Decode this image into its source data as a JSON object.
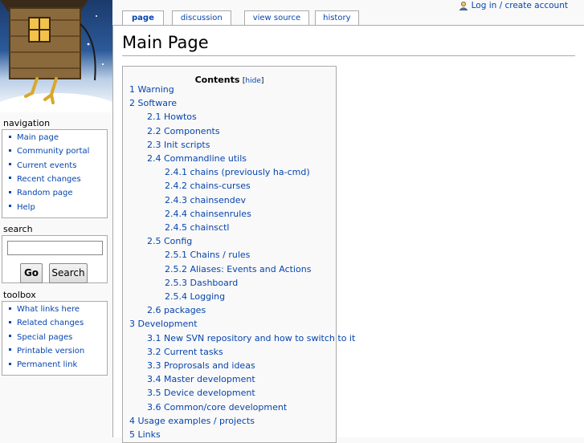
{
  "personal": {
    "icon": "user-icon",
    "login_label": "Log in / create account"
  },
  "tabs": [
    {
      "label": "page",
      "selected": true
    },
    {
      "label": "discussion"
    },
    {
      "label": "view source"
    },
    {
      "label": "history"
    }
  ],
  "page": {
    "title": "Main Page"
  },
  "toc": {
    "title": "Contents",
    "hide_open": "[",
    "hide_label": "hide",
    "hide_close": "]",
    "items": [
      {
        "num": "1",
        "text": "Warning"
      },
      {
        "num": "2",
        "text": "Software"
      },
      {
        "num": "2.1",
        "text": "Howtos"
      },
      {
        "num": "2.2",
        "text": "Components"
      },
      {
        "num": "2.3",
        "text": "Init scripts"
      },
      {
        "num": "2.4",
        "text": "Commandline utils"
      },
      {
        "num": "2.4.1",
        "text": "chains (previously ha-cmd)"
      },
      {
        "num": "2.4.2",
        "text": "chains-curses"
      },
      {
        "num": "2.4.3",
        "text": "chainsendev"
      },
      {
        "num": "2.4.4",
        "text": "chainsenrules"
      },
      {
        "num": "2.4.5",
        "text": "chainsctl"
      },
      {
        "num": "2.5",
        "text": "Config"
      },
      {
        "num": "2.5.1",
        "text": "Chains / rules"
      },
      {
        "num": "2.5.2",
        "text": "Aliases: Events and Actions"
      },
      {
        "num": "2.5.3",
        "text": "Dashboard"
      },
      {
        "num": "2.5.4",
        "text": "Logging"
      },
      {
        "num": "2.6",
        "text": "packages"
      },
      {
        "num": "3",
        "text": "Development"
      },
      {
        "num": "3.1",
        "text": "New SVN repository and how to switch to it"
      },
      {
        "num": "3.2",
        "text": "Current tasks"
      },
      {
        "num": "3.3",
        "text": "Proprosals and ideas"
      },
      {
        "num": "3.4",
        "text": "Master development"
      },
      {
        "num": "3.5",
        "text": "Device development"
      },
      {
        "num": "3.6",
        "text": "Common/core development"
      },
      {
        "num": "4",
        "text": "Usage examples / projects"
      },
      {
        "num": "5",
        "text": "Links"
      }
    ]
  },
  "sidebar": {
    "navigation": {
      "title": "navigation",
      "items": [
        "Main page",
        "Community portal",
        "Current events",
        "Recent changes",
        "Random page",
        "Help"
      ]
    },
    "search": {
      "title": "search",
      "input_value": "",
      "go_label": "Go",
      "search_label": "Search"
    },
    "toolbox": {
      "title": "toolbox",
      "items": [
        "What links here",
        "Related changes",
        "Special pages",
        "Printable version",
        "Permanent link"
      ]
    }
  },
  "colors": {
    "link": "#0645ad",
    "border": "#aaaaaa",
    "background": "#f9f9f9"
  }
}
